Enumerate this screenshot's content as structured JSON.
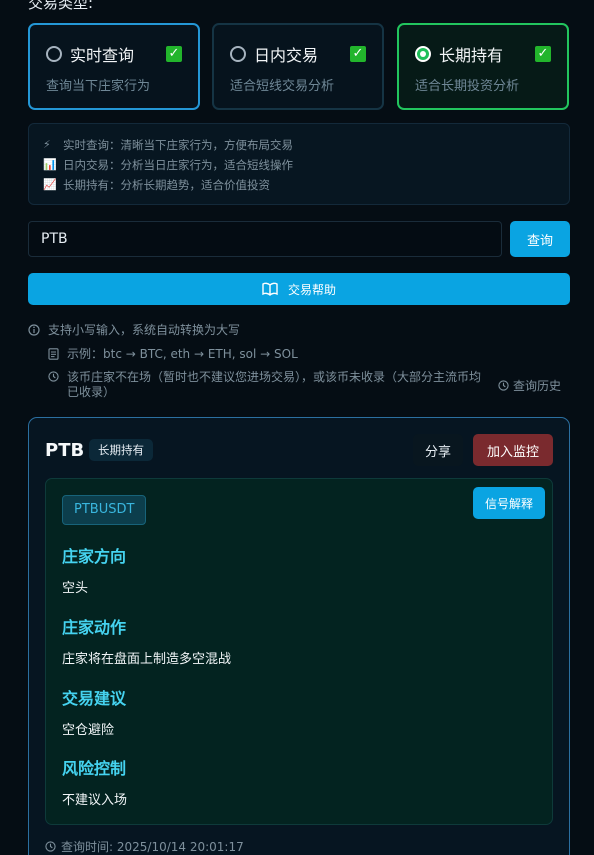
{
  "section_label": "交易类型:",
  "modes": [
    {
      "title": "实时查询",
      "desc": "查询当下庄家行为",
      "selected": false,
      "checked": true
    },
    {
      "title": "日内交易",
      "desc": "适合短线交易分析",
      "selected": false,
      "checked": true
    },
    {
      "title": "长期持有",
      "desc": "适合长期投资分析",
      "selected": true,
      "checked": true
    }
  ],
  "info": [
    {
      "icon": "⚡",
      "text": "实时查询：清晰当下庄家行为，方便布局交易"
    },
    {
      "icon": "📊",
      "text": "日内交易：分析当日庄家行为，适合短线操作"
    },
    {
      "icon": "📈",
      "text": "长期持有：分析长期趋势，适合价值投资"
    }
  ],
  "search": {
    "value": "PTB",
    "button": "查询"
  },
  "help_button": "交易帮助",
  "hints": {
    "lowercase": "支持小写输入，系统自动转换为大写",
    "example": "示例：btc → BTC, eth → ETH, sol → SOL",
    "notice": "该币庄家不在场（暂时也不建议您进场交易），或该币未收录（大部分主流币均已收录）",
    "history": "查询历史"
  },
  "result": {
    "symbol": "PTB",
    "mode_badge": "长期持有",
    "share": "分享",
    "monitor": "加入监控",
    "pair": "PTBUSDT",
    "explain": "信号解释",
    "items": [
      {
        "title": "庄家方向",
        "value": "空头"
      },
      {
        "title": "庄家动作",
        "value": "庄家将在盘面上制造多空混战"
      },
      {
        "title": "交易建议",
        "value": "空仓避险"
      },
      {
        "title": "风险控制",
        "value": "不建议入场"
      }
    ],
    "query_time": "查询时间: 2025/10/14 20:01:17"
  },
  "colors": {
    "accent": "#0aa4e2",
    "selected_border": "#22c55e",
    "danger": "#7a2a2e",
    "signal_title": "#45d3f0"
  }
}
